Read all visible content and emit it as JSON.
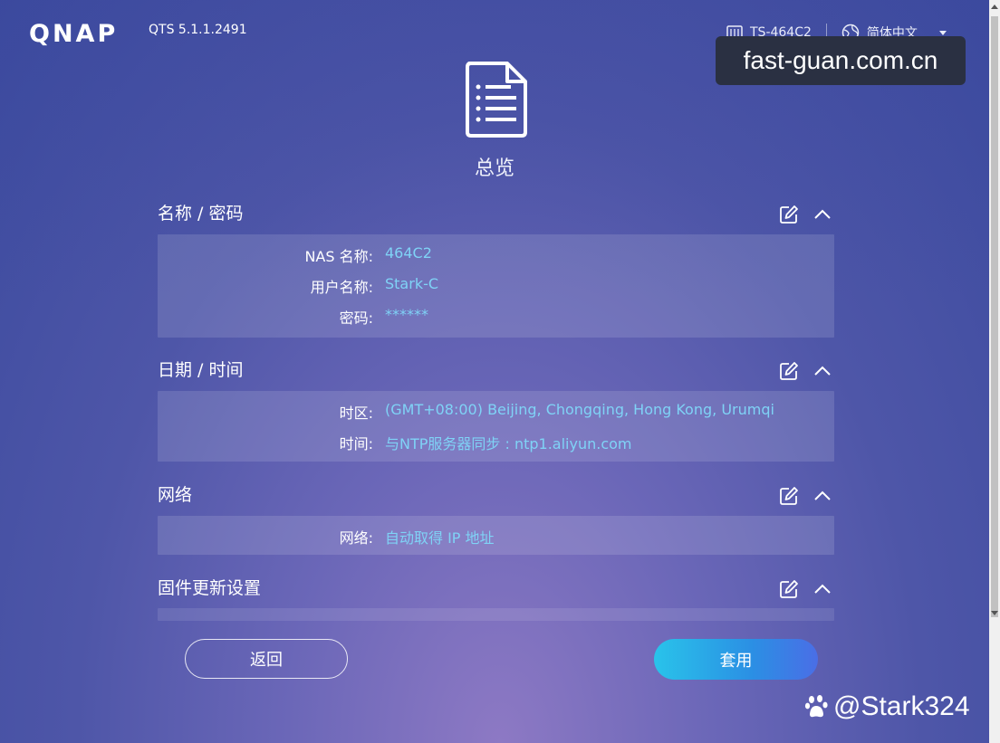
{
  "header": {
    "brand": "QNAP",
    "version": "QTS 5.1.1.2491",
    "model": "TS-464C2",
    "language": "简体中文"
  },
  "watermark": {
    "text": "fast-guan.com.cn"
  },
  "page": {
    "title": "总览"
  },
  "sections": {
    "name_password": {
      "title": "名称 / 密码",
      "rows": [
        {
          "label": "NAS 名称:",
          "value": "464C2"
        },
        {
          "label": "用户名称:",
          "value": "Stark-C"
        },
        {
          "label": "密码:",
          "value": "******"
        }
      ]
    },
    "datetime": {
      "title": "日期 / 时间",
      "rows": [
        {
          "label": "时区:",
          "value": "(GMT+08:00) Beijing, Chongqing, Hong Kong, Urumqi"
        },
        {
          "label": "时间:",
          "value": "与NTP服务器同步 : ntp1.aliyun.com"
        }
      ]
    },
    "network": {
      "title": "网络",
      "rows": [
        {
          "label": "网络:",
          "value": "自动取得 IP 地址"
        }
      ]
    },
    "firmware": {
      "title": "固件更新设置"
    }
  },
  "buttons": {
    "back": "返回",
    "apply": "套用"
  },
  "credit": {
    "text": "@Stark324"
  },
  "colors": {
    "value_text": "#7fd3f6",
    "apply_start": "#29c3ea",
    "apply_end": "#4a6ee6"
  }
}
